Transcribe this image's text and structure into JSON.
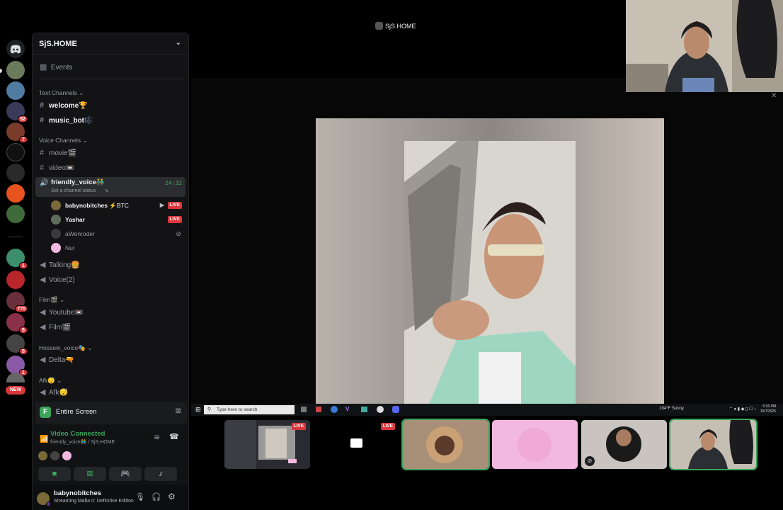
{
  "server": {
    "name": "SjS.HOME",
    "events_label": "Events",
    "categories": {
      "text": "Text Channels",
      "voice": "Voice Channels",
      "film": "Film🎬",
      "hossein": "Hossein_voice🎭",
      "afk": "Afk😴"
    },
    "text_channels": [
      "welcome🏆",
      "music_bot🎼"
    ],
    "voice_channels_top": [
      "movie🎬",
      "video📼"
    ],
    "active_voice": {
      "name": "friendly_voice👬",
      "status": "Set a channel status",
      "timer": "24:32"
    },
    "voice_users": [
      {
        "name": "babynobitches",
        "tag": "⚡BTC",
        "live": "LIVE"
      },
      {
        "name": "Yashar",
        "live": "LIVE"
      },
      {
        "name": "aWenroder"
      },
      {
        "name": "Nur"
      }
    ],
    "voice_channels_more": [
      "Talking🍔",
      "Voice(2)"
    ],
    "film_channels": [
      "Youtube📼",
      "Film🎬"
    ],
    "hossein_channels": [
      "Delta🔫"
    ],
    "afk_channels": [
      "Afk😴"
    ]
  },
  "rail": {
    "new_badge": "NEW",
    "badges": [
      "52",
      "7",
      "1",
      "770",
      "5",
      "5",
      "1"
    ]
  },
  "screen_share": {
    "label": "Entire Screen"
  },
  "voice_panel": {
    "status": "Video Connected",
    "location": "friendly_voice👬 / SjS.HOME"
  },
  "user_panel": {
    "name": "babynobitches",
    "activity": "Streaming Mafia II: Definitive Edition"
  },
  "stage": {
    "title": "SjS.HOME",
    "live_label": "LIVE"
  },
  "taskbar": {
    "search_placeholder": "Type here to search",
    "weather": "104°F  Sunny",
    "time": "5:16 PM",
    "date": "10/7/2025"
  },
  "colors": {
    "accent_green": "#3ba55c",
    "live_red": "#da373c",
    "bg": "#000000"
  }
}
